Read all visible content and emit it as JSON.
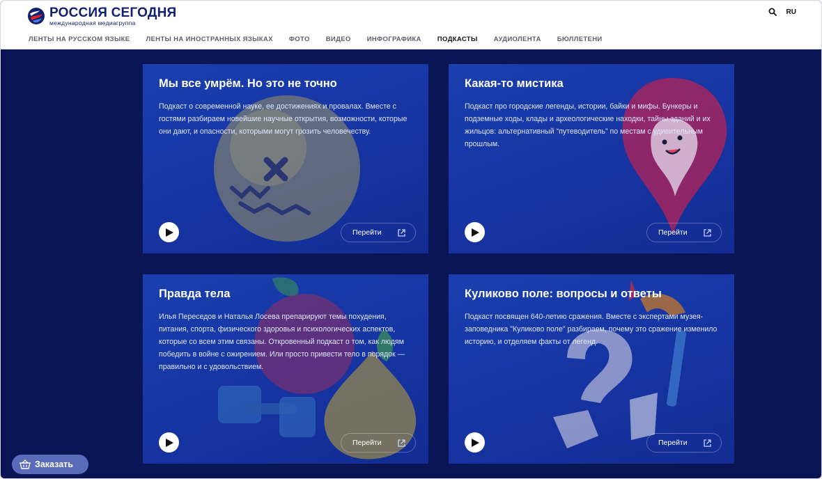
{
  "header": {
    "logo_title": "РОССИЯ СЕГОДНЯ",
    "logo_subtitle": "международная медиагруппа",
    "search_icon": "search-icon",
    "lang": "RU"
  },
  "nav": [
    {
      "label": "ЛЕНТЫ НА РУССКОМ ЯЗЫКЕ",
      "active": false
    },
    {
      "label": "ЛЕНТЫ НА ИНОСТРАННЫХ ЯЗЫКАХ",
      "active": false
    },
    {
      "label": "ФОТО",
      "active": false
    },
    {
      "label": "ВИДЕО",
      "active": false
    },
    {
      "label": "ИНФОГРАФИКА",
      "active": false
    },
    {
      "label": "ПОДКАСТЫ",
      "active": true
    },
    {
      "label": "АУДИОЛЕНТА",
      "active": false
    },
    {
      "label": "БЮЛЛЕТЕНИ",
      "active": false
    }
  ],
  "podcasts": [
    {
      "title": "Мы все умрём. Но это не точно",
      "description": "Подкаст о современной науке, ее достижениях и провалах. Вместе с гостями разбираем новейшие научные открытия, возможности, которые они дают, и опасности, которыми могут грозить человечеству.",
      "go_label": "Перейти",
      "art": "dizzy-face-ball"
    },
    {
      "title": "Какая-то мистика",
      "description": "Подкаст про городские легенды, истории, байки и мифы. Бункеры и подземные ходы, клады и археологические находки, тайны зданий и их жильцов: альтернативный “путеводитель” по местам с удивительным прошлым.",
      "go_label": "Перейти",
      "art": "map-pin-ghost"
    },
    {
      "title": "Правда тела",
      "description": "Илья Переседов и Наталья Лосева препарируют темы похудения, питания, спорта, физического здоровья и психологических аспектов, которые со всем этим связаны. Откровенный подкаст о том, как людям победить в войне с ожирением. Или просто привести тело в порядок — правильно и с удовольствием.",
      "go_label": "Перейти",
      "art": "apple-pear-dumbbell"
    },
    {
      "title": "Куликово поле: вопросы и ответы",
      "description": "Подкаст посвящен 640-летию сражения. Вместе с экспертами музея-заповедника \"Куликово поле\" разбираем, почему это сражение изменило историю, и отделяем факты от легенд.",
      "go_label": "Перейти",
      "art": "question-mark-axe"
    }
  ],
  "order_button": {
    "label": "Заказать",
    "icon": "basket-icon"
  },
  "colors": {
    "page_bg": "#0a1556",
    "card_bg": "#1634a2",
    "brand": "#12206e",
    "order_bg": "#5a6bb9"
  }
}
